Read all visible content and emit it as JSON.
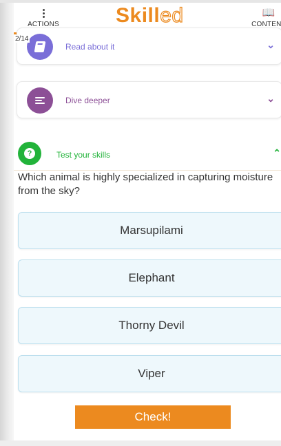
{
  "header": {
    "actions_label": "ACTIONS",
    "logo_part_a": "Skill",
    "logo_part_b": "ed",
    "content_label": "CONTENT",
    "progress_fraction": 0.143
  },
  "counter": "2/14",
  "sections": [
    {
      "title": "Read about it",
      "icon": "book-icon",
      "color": "#7a6ed8",
      "chevron": "chevron-down-icon"
    },
    {
      "title": "Dive deeper",
      "icon": "lines-icon",
      "color": "#8c4f96",
      "chevron": "chevron-down-icon"
    },
    {
      "title": "Test your skills",
      "icon": "question-icon",
      "color": "#22b33a",
      "chevron": "chevron-up-icon"
    }
  ],
  "quiz": {
    "question": "Which animal is highly specialized in capturing moisture from the sky?",
    "answers": [
      "Marsupilami",
      "Elephant",
      "Thorny Devil",
      "Viper"
    ],
    "check_label": "Check!"
  },
  "colors": {
    "accent": "#ec8a1f",
    "answer_bg": "#eef8fc",
    "answer_border": "#bcdfee"
  }
}
